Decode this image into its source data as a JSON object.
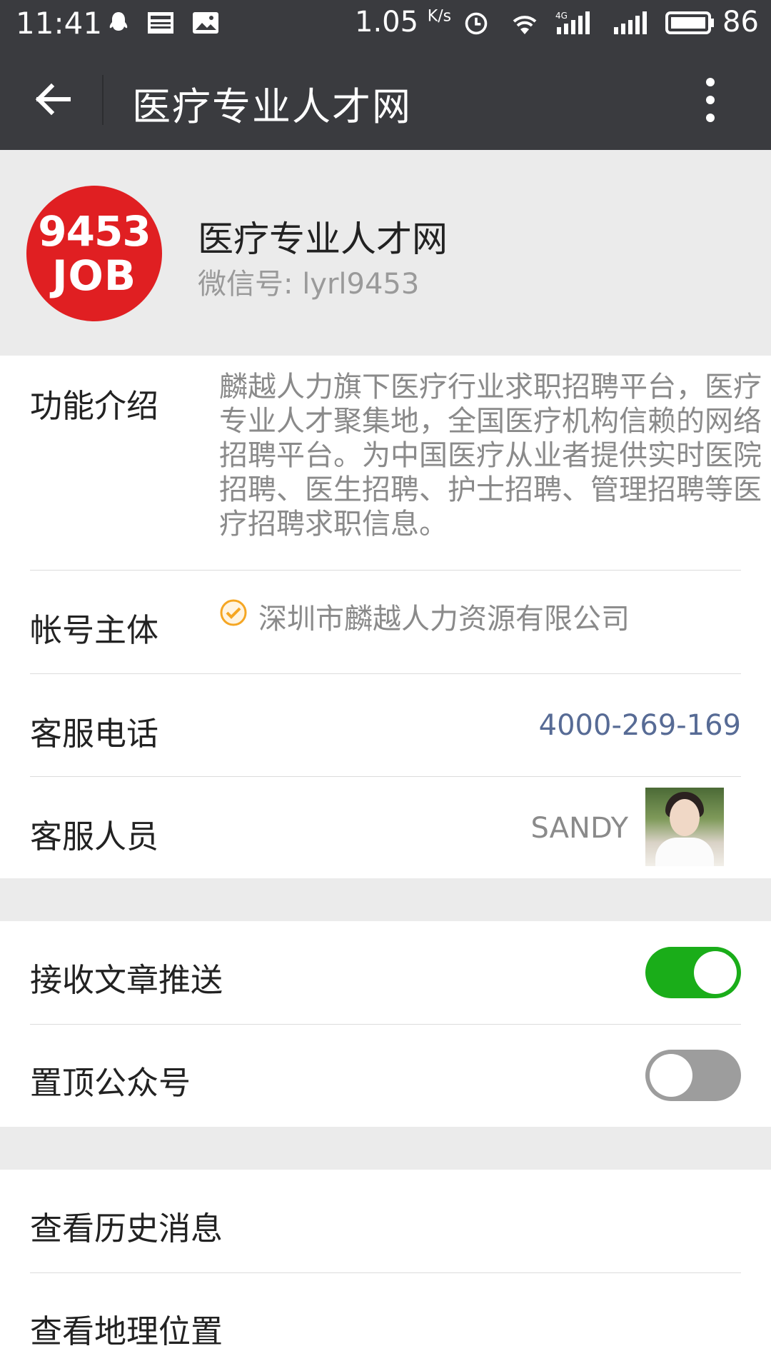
{
  "status_bar": {
    "time": "11:41",
    "net_speed": "1.05",
    "net_unit": "K/s",
    "battery": "86",
    "icons": [
      "qq-icon",
      "news-icon",
      "image-icon",
      "alarm-icon",
      "wifi-icon",
      "4g-signal-icon",
      "signal-icon",
      "battery-icon"
    ]
  },
  "title_bar": {
    "title": "医疗专业人才网"
  },
  "profile": {
    "logo_line1": "9453",
    "logo_line2": "JOB",
    "name": "医疗专业人才网",
    "wechat_id": "微信号: lyrl9453"
  },
  "info": {
    "intro_label": "功能介绍",
    "intro_text": "麟越人力旗下医疗行业求职招聘平台，医疗专业人才聚集地，全国医疗机构信赖的网络招聘平台。为中国医疗从业者提供实时医院招聘、医生招聘、护士招聘、管理招聘等医疗招聘求职信息。",
    "owner_label": "帐号主体",
    "owner_value": "深圳市麟越人力资源有限公司",
    "phone_label": "客服电话",
    "phone_value": "4000-269-169",
    "staff_label": "客服人员",
    "staff_name": "SANDY"
  },
  "settings": {
    "receive_label": "接收文章推送",
    "receive_on": true,
    "pin_label": "置顶公众号",
    "pin_on": false
  },
  "actions": {
    "history_label": "查看历史消息",
    "location_label": "查看地理位置"
  },
  "colors": {
    "bar": "#3a3b3f",
    "logo_red": "#e01f22",
    "toggle_on": "#1aad19",
    "link_blue": "#576b95",
    "verify_orange": "#f5a623"
  }
}
